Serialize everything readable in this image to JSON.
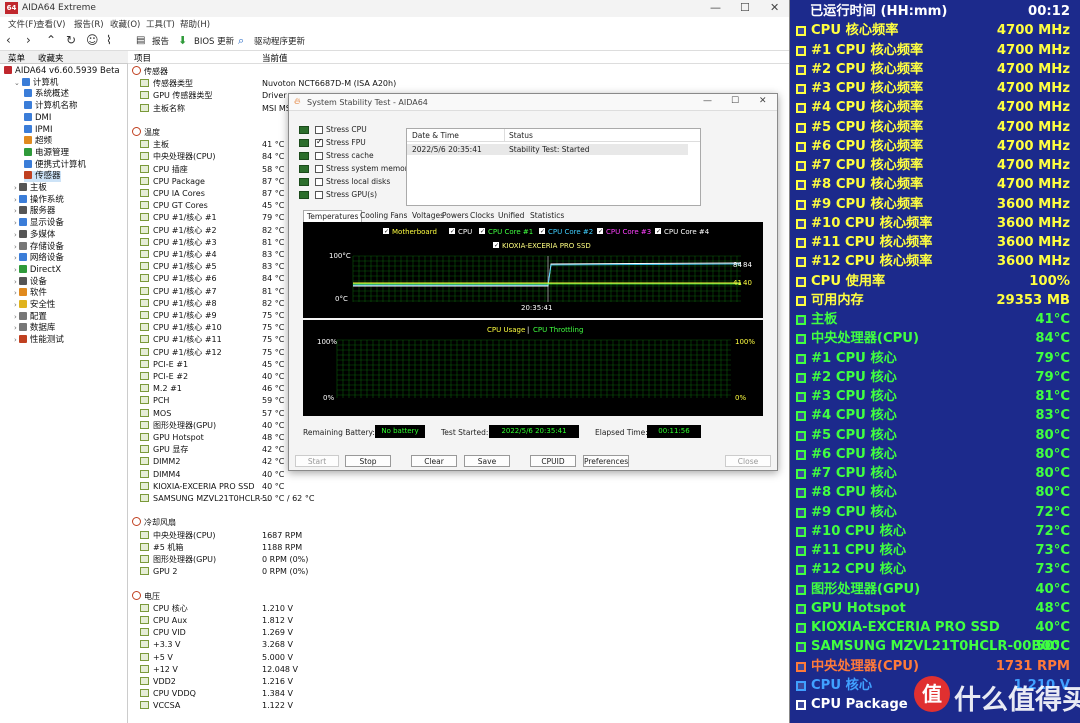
{
  "app": {
    "title": "AIDA64 Extreme",
    "menu": [
      "文件(F)",
      "查看(V)",
      "报告(R)",
      "收藏(O)",
      "工具(T)",
      "帮助(H)"
    ],
    "toolbar": {
      "report": "报告",
      "bios": "BIOS 更新",
      "driver": "驱动程序更新"
    },
    "left_tabs": [
      "菜单",
      "收藏夹"
    ],
    "columns": {
      "item": "项目",
      "value": "当前值"
    }
  },
  "tree": [
    {
      "label": "AIDA64 v6.60.5939 Beta",
      "indent": 0,
      "color": "#c0272d"
    },
    {
      "label": "计算机",
      "indent": 1,
      "color": "#3b7dd8"
    },
    {
      "label": "系统概述",
      "indent": 2,
      "color": "#3b7dd8"
    },
    {
      "label": "计算机名称",
      "indent": 2,
      "color": "#3b7dd8"
    },
    {
      "label": "DMI",
      "indent": 2,
      "color": "#3b7dd8"
    },
    {
      "label": "IPMI",
      "indent": 2,
      "color": "#3b7dd8"
    },
    {
      "label": "超频",
      "indent": 2,
      "color": "#e08a1e"
    },
    {
      "label": "电源管理",
      "indent": 2,
      "color": "#2f9a3a"
    },
    {
      "label": "便携式计算机",
      "indent": 2,
      "color": "#3b7dd8"
    },
    {
      "label": "传感器",
      "indent": 2,
      "color": "#c04020",
      "selected": true
    },
    {
      "label": "主板",
      "indent": 1,
      "color": "#555"
    },
    {
      "label": "操作系统",
      "indent": 1,
      "color": "#3b7dd8"
    },
    {
      "label": "服务器",
      "indent": 1,
      "color": "#555"
    },
    {
      "label": "显示设备",
      "indent": 1,
      "color": "#3b7dd8"
    },
    {
      "label": "多媒体",
      "indent": 1,
      "color": "#555"
    },
    {
      "label": "存储设备",
      "indent": 1,
      "color": "#777"
    },
    {
      "label": "网络设备",
      "indent": 1,
      "color": "#3b7dd8"
    },
    {
      "label": "DirectX",
      "indent": 1,
      "color": "#2f9a3a"
    },
    {
      "label": "设备",
      "indent": 1,
      "color": "#555"
    },
    {
      "label": "软件",
      "indent": 1,
      "color": "#e08a1e"
    },
    {
      "label": "安全性",
      "indent": 1,
      "color": "#e0b31e"
    },
    {
      "label": "配置",
      "indent": 1,
      "color": "#777"
    },
    {
      "label": "数据库",
      "indent": 1,
      "color": "#777"
    },
    {
      "label": "性能测试",
      "indent": 1,
      "color": "#c04020"
    }
  ],
  "sensor_rows": [
    {
      "label": "传感器",
      "value": "",
      "section": true
    },
    {
      "label": "传感器类型",
      "value": "Nuvoton NCT6687D-M  (ISA A20h)"
    },
    {
      "label": "GPU 传感器类型",
      "value": "Driver"
    },
    {
      "label": "主板名称",
      "value": "MSI MS"
    },
    {
      "label": "",
      "value": ""
    },
    {
      "label": "温度",
      "value": "",
      "section": true
    },
    {
      "label": "主板",
      "value": "41 °C"
    },
    {
      "label": "中央处理器(CPU)",
      "value": "84 °C"
    },
    {
      "label": "CPU 插座",
      "value": "58 °C"
    },
    {
      "label": "CPU Package",
      "value": "87 °C"
    },
    {
      "label": "CPU IA Cores",
      "value": "87 °C"
    },
    {
      "label": "CPU GT Cores",
      "value": "45 °C"
    },
    {
      "label": "CPU #1/核心 #1",
      "value": "79 °C"
    },
    {
      "label": "CPU #1/核心 #2",
      "value": "82 °C"
    },
    {
      "label": "CPU #1/核心 #3",
      "value": "81 °C"
    },
    {
      "label": "CPU #1/核心 #4",
      "value": "83 °C"
    },
    {
      "label": "CPU #1/核心 #5",
      "value": "83 °C"
    },
    {
      "label": "CPU #1/核心 #6",
      "value": "84 °C"
    },
    {
      "label": "CPU #1/核心 #7",
      "value": "81 °C"
    },
    {
      "label": "CPU #1/核心 #8",
      "value": "82 °C"
    },
    {
      "label": "CPU #1/核心 #9",
      "value": "75 °C"
    },
    {
      "label": "CPU #1/核心 #10",
      "value": "75 °C"
    },
    {
      "label": "CPU #1/核心 #11",
      "value": "75 °C"
    },
    {
      "label": "CPU #1/核心 #12",
      "value": "75 °C"
    },
    {
      "label": "PCI-E #1",
      "value": "45 °C"
    },
    {
      "label": "PCI-E #2",
      "value": "40 °C"
    },
    {
      "label": "M.2 #1",
      "value": "46 °C"
    },
    {
      "label": "PCH",
      "value": "59 °C"
    },
    {
      "label": "MOS",
      "value": "57 °C"
    },
    {
      "label": "图形处理器(GPU)",
      "value": "40 °C"
    },
    {
      "label": "GPU Hotspot",
      "value": "48 °C"
    },
    {
      "label": "GPU 显存",
      "value": "42 °C"
    },
    {
      "label": "DIMM2",
      "value": "42 °C"
    },
    {
      "label": "DIMM4",
      "value": "40 °C"
    },
    {
      "label": "KIOXIA-EXCERIA PRO SSD",
      "value": "40 °C"
    },
    {
      "label": "SAMSUNG MZVL21T0HCLR-...",
      "value": "50 °C / 62 °C"
    },
    {
      "label": "",
      "value": ""
    },
    {
      "label": "冷却风扇",
      "value": "",
      "section": true
    },
    {
      "label": "中央处理器(CPU)",
      "value": "1687 RPM"
    },
    {
      "label": "#5 机箱",
      "value": "1188 RPM"
    },
    {
      "label": "图形处理器(GPU)",
      "value": "0 RPM  (0%)"
    },
    {
      "label": "GPU 2",
      "value": "0 RPM  (0%)"
    },
    {
      "label": "",
      "value": ""
    },
    {
      "label": "电压",
      "value": "",
      "section": true
    },
    {
      "label": "CPU 核心",
      "value": "1.210 V"
    },
    {
      "label": "CPU Aux",
      "value": "1.812 V"
    },
    {
      "label": "CPU VID",
      "value": "1.269 V"
    },
    {
      "label": "+3.3 V",
      "value": "3.268 V"
    },
    {
      "label": "+5 V",
      "value": "5.000 V"
    },
    {
      "label": "+12 V",
      "value": "12.048 V"
    },
    {
      "label": "VDD2",
      "value": "1.216 V"
    },
    {
      "label": "CPU VDDQ",
      "value": "1.384 V"
    },
    {
      "label": "VCCSA",
      "value": "1.122 V"
    }
  ],
  "dialog": {
    "title": "System Stability Test - AIDA64",
    "stress": [
      {
        "label": "Stress CPU",
        "checked": false
      },
      {
        "label": "Stress FPU",
        "checked": true
      },
      {
        "label": "Stress cache",
        "checked": false
      },
      {
        "label": "Stress system memory",
        "checked": false
      },
      {
        "label": "Stress local disks",
        "checked": false
      },
      {
        "label": "Stress GPU(s)",
        "checked": false
      }
    ],
    "status_headers": {
      "date": "Date & Time",
      "status": "Status"
    },
    "status_row": {
      "date": "2022/5/6 20:35:41",
      "status": "Stability Test: Started"
    },
    "tabs": [
      "Temperatures",
      "Cooling Fans",
      "Voltages",
      "Powers",
      "Clocks",
      "Unified",
      "Statistics"
    ],
    "legend": [
      {
        "label": "Motherboard",
        "color": "#ffff40"
      },
      {
        "label": "CPU",
        "color": "#ffffff"
      },
      {
        "label": "CPU Core #1",
        "color": "#40ff40"
      },
      {
        "label": "CPU Core #2",
        "color": "#40d0ff"
      },
      {
        "label": "CPU Core #3",
        "color": "#ff40ff"
      },
      {
        "label": "CPU Core #4",
        "color": "#ffffff"
      },
      {
        "label": "KIOXIA-EXCERIA PRO SSD",
        "color": "#ffff80"
      }
    ],
    "graph1": {
      "ymax": "100°C",
      "ymin": "0°C",
      "xlabel": "20:35:41",
      "r1": "84",
      "r2": "84",
      "r3": "41",
      "r4": "40"
    },
    "graph2": {
      "title1": "CPU Usage",
      "sep": "|",
      "title2": "CPU Throttling",
      "ylmax": "100%",
      "ylmin": "0%",
      "yrmax": "100%",
      "yrmin": "0%"
    },
    "info": {
      "battery_label": "Remaining Battery:",
      "battery": "No battery",
      "started_label": "Test Started:",
      "started": "2022/5/6 20:35:41",
      "elapsed_label": "Elapsed Time:",
      "elapsed": "00:11:56"
    },
    "buttons": {
      "start": "Start",
      "stop": "Stop",
      "clear": "Clear",
      "save": "Save",
      "cpuid": "CPUID",
      "prefs": "Preferences",
      "close": "Close"
    }
  },
  "overlay": [
    {
      "label": "已运行时间 (HH:mm)",
      "value": "00:12",
      "color": "#ffffff",
      "vcolor": "#ffffff",
      "icon": "none"
    },
    {
      "label": "CPU 核心频率",
      "value": "4700 MHz",
      "color": "#ffff40",
      "vcolor": "#ffff40",
      "icon": "chip"
    },
    {
      "label": "#1 CPU 核心频率",
      "value": "4700 MHz",
      "color": "#ffff40",
      "vcolor": "#ffff40",
      "icon": "chip"
    },
    {
      "label": "#2 CPU 核心频率",
      "value": "4700 MHz",
      "color": "#ffff40",
      "vcolor": "#ffff40",
      "icon": "chip"
    },
    {
      "label": "#3 CPU 核心频率",
      "value": "4700 MHz",
      "color": "#ffff40",
      "vcolor": "#ffff40",
      "icon": "chip"
    },
    {
      "label": "#4 CPU 核心频率",
      "value": "4700 MHz",
      "color": "#ffff40",
      "vcolor": "#ffff40",
      "icon": "chip"
    },
    {
      "label": "#5 CPU 核心频率",
      "value": "4700 MHz",
      "color": "#ffff40",
      "vcolor": "#ffff40",
      "icon": "chip"
    },
    {
      "label": "#6 CPU 核心频率",
      "value": "4700 MHz",
      "color": "#ffff40",
      "vcolor": "#ffff40",
      "icon": "chip"
    },
    {
      "label": "#7 CPU 核心频率",
      "value": "4700 MHz",
      "color": "#ffff40",
      "vcolor": "#ffff40",
      "icon": "chip"
    },
    {
      "label": "#8 CPU 核心频率",
      "value": "4700 MHz",
      "color": "#ffff40",
      "vcolor": "#ffff40",
      "icon": "chip"
    },
    {
      "label": "#9 CPU 核心频率",
      "value": "3600 MHz",
      "color": "#ffff40",
      "vcolor": "#ffff40",
      "icon": "chip"
    },
    {
      "label": "#10 CPU 核心频率",
      "value": "3600 MHz",
      "color": "#ffff40",
      "vcolor": "#ffff40",
      "icon": "chip"
    },
    {
      "label": "#11 CPU 核心频率",
      "value": "3600 MHz",
      "color": "#ffff40",
      "vcolor": "#ffff40",
      "icon": "chip"
    },
    {
      "label": "#12 CPU 核心频率",
      "value": "3600 MHz",
      "color": "#ffff40",
      "vcolor": "#ffff40",
      "icon": "chip"
    },
    {
      "label": "CPU 使用率",
      "value": "100%",
      "color": "#ffff40",
      "vcolor": "#ffff40",
      "icon": "bar"
    },
    {
      "label": "可用内存",
      "value": "29353 MB",
      "color": "#ffff40",
      "vcolor": "#ffff40",
      "icon": "mem"
    },
    {
      "label": "主板",
      "value": "41°C",
      "color": "#40ff40",
      "vcolor": "#40ff40",
      "icon": "board"
    },
    {
      "label": "中央处理器(CPU)",
      "value": "84°C",
      "color": "#40ff40",
      "vcolor": "#40ff40",
      "icon": "chip"
    },
    {
      "label": " #1 CPU 核心",
      "value": "79°C",
      "color": "#40ff40",
      "vcolor": "#40ff40",
      "icon": "chip"
    },
    {
      "label": " #2 CPU 核心",
      "value": "79°C",
      "color": "#40ff40",
      "vcolor": "#40ff40",
      "icon": "chip"
    },
    {
      "label": " #3 CPU 核心",
      "value": "81°C",
      "color": "#40ff40",
      "vcolor": "#40ff40",
      "icon": "chip"
    },
    {
      "label": " #4 CPU 核心",
      "value": "83°C",
      "color": "#40ff40",
      "vcolor": "#40ff40",
      "icon": "chip"
    },
    {
      "label": " #5 CPU 核心",
      "value": "80°C",
      "color": "#40ff40",
      "vcolor": "#40ff40",
      "icon": "chip"
    },
    {
      "label": " #6 CPU 核心",
      "value": "80°C",
      "color": "#40ff40",
      "vcolor": "#40ff40",
      "icon": "chip"
    },
    {
      "label": " #7 CPU 核心",
      "value": "80°C",
      "color": "#40ff40",
      "vcolor": "#40ff40",
      "icon": "chip"
    },
    {
      "label": " #8 CPU 核心",
      "value": "80°C",
      "color": "#40ff40",
      "vcolor": "#40ff40",
      "icon": "chip"
    },
    {
      "label": " #9 CPU 核心",
      "value": "72°C",
      "color": "#40ff40",
      "vcolor": "#40ff40",
      "icon": "chip"
    },
    {
      "label": " #10 CPU 核心",
      "value": "72°C",
      "color": "#40ff40",
      "vcolor": "#40ff40",
      "icon": "chip"
    },
    {
      "label": " #11 CPU 核心",
      "value": "73°C",
      "color": "#40ff40",
      "vcolor": "#40ff40",
      "icon": "chip"
    },
    {
      "label": " #12 CPU 核心",
      "value": "73°C",
      "color": "#40ff40",
      "vcolor": "#40ff40",
      "icon": "chip"
    },
    {
      "label": "图形处理器(GPU)",
      "value": "40°C",
      "color": "#40ff40",
      "vcolor": "#40ff40",
      "icon": "gpu"
    },
    {
      "label": "GPU Hotspot",
      "value": "48°C",
      "color": "#40ff40",
      "vcolor": "#40ff40",
      "icon": "gpu"
    },
    {
      "label": "KIOXIA-EXCERIA PRO SSD",
      "value": "40°C",
      "color": "#40ff40",
      "vcolor": "#40ff40",
      "icon": "disk"
    },
    {
      "label": "SAMSUNG MZVL21T0HCLR-00B00",
      "value": "50°C",
      "color": "#40ff40",
      "vcolor": "#40ff40",
      "icon": "disk"
    },
    {
      "label": "中央处理器(CPU)",
      "value": "1731 RPM",
      "color": "#ff7a3a",
      "vcolor": "#ff7a3a",
      "icon": "fan"
    },
    {
      "label": "CPU 核心",
      "value": "1.210 V",
      "color": "#40a0ff",
      "vcolor": "#40a0ff",
      "icon": "chip"
    },
    {
      "label": "CPU Package",
      "value": "",
      "color": "#ffffff",
      "vcolor": "#ffffff",
      "icon": "chip"
    }
  ],
  "watermark": "什么值得买"
}
